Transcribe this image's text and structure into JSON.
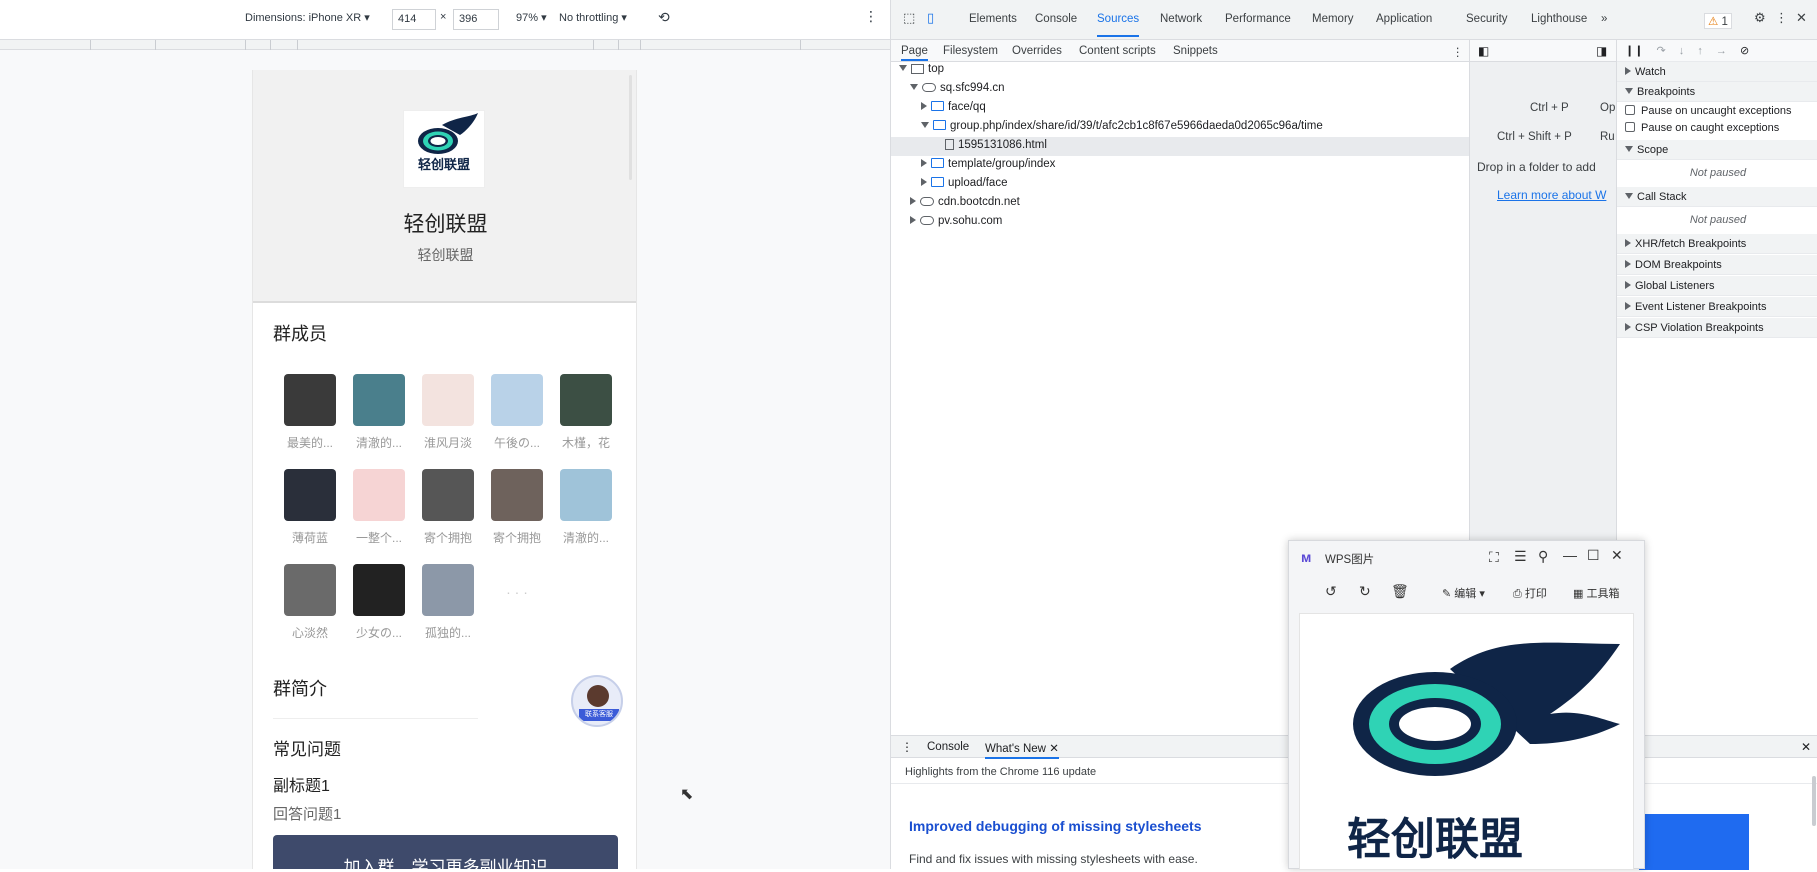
{
  "device_toolbar": {
    "dimensions_label": "Dimensions: iPhone XR",
    "width": "414",
    "times": "×",
    "height": "396",
    "zoom": "97%",
    "throttling": "No throttling"
  },
  "phone": {
    "group_title": "轻创联盟",
    "group_subtitle": "轻创联盟",
    "logo_text": "轻创联盟",
    "members_title": "群成员",
    "members": [
      {
        "name": "最美的...",
        "color": "#3a3a3a"
      },
      {
        "name": "清澈的...",
        "color": "#4a7f8c"
      },
      {
        "name": "淮风月淡",
        "color": "#f3e3df"
      },
      {
        "name": "午後の...",
        "color": "#b9d2e8"
      },
      {
        "name": "木槿，花",
        "color": "#3c4f44"
      },
      {
        "name": "薄荷蓝",
        "color": "#2a2f3a"
      },
      {
        "name": "一整个...",
        "color": "#f6d4d4"
      },
      {
        "name": "寄个拥抱",
        "color": "#565656"
      },
      {
        "name": "寄个拥抱",
        "color": "#6e625c"
      },
      {
        "name": "清澈的...",
        "color": "#9fc3d9"
      },
      {
        "name": "心淡然",
        "color": "#6a6a6a"
      },
      {
        "name": "少女の...",
        "color": "#222222"
      },
      {
        "name": "孤独的...",
        "color": "#8c98a8"
      }
    ],
    "intro_title": "群简介",
    "faq_title": "常见问题",
    "faq_subtitle": "副标题1",
    "faq_answer": "回答问题1",
    "join_button": "加入群，学习更多副业知识",
    "service_badge": "联系客服"
  },
  "devtools": {
    "tabs": [
      "Elements",
      "Console",
      "Sources",
      "Network",
      "Performance",
      "Memory",
      "Application",
      "Security",
      "Lighthouse"
    ],
    "active_tab": "Sources",
    "more_tabs": "»",
    "warning_count": "1",
    "sub_tabs": [
      "Page",
      "Filesystem",
      "Overrides",
      "Content scripts",
      "Snippets"
    ],
    "tree": {
      "top": "top",
      "domain": "sq.sfc994.cn",
      "face": "face/qq",
      "group": "group.php/index/share/id/39/t/afc2cb1c8f67e5966daeda0d2065c96a/time",
      "file": "1595131086.html",
      "template": "template/group/index",
      "upload": "upload/face",
      "cdn": "cdn.bootcdn.net",
      "sohu": "pv.sohu.com"
    },
    "editor": {
      "shortcut1": "Ctrl + P",
      "shortcut1_action": "Op",
      "shortcut2": "Ctrl + Shift + P",
      "shortcut2_action": "Ru",
      "drop_text": "Drop in a folder to add",
      "learn_more": "Learn more about W"
    },
    "right_panel": {
      "watch": "Watch",
      "breakpoints": "Breakpoints",
      "pause_uncaught": "Pause on uncaught exceptions",
      "pause_caught": "Pause on caught exceptions",
      "scope": "Scope",
      "not_paused": "Not paused",
      "call_stack": "Call Stack",
      "not_paused2": "Not paused",
      "xhr": "XHR/fetch Breakpoints",
      "dom": "DOM Breakpoints",
      "global": "Global Listeners",
      "event": "Event Listener Breakpoints",
      "csp": "CSP Violation Breakpoints"
    },
    "drawer": {
      "tab_console": "Console",
      "tab_whatsnew": "What's New",
      "highlights": "Highlights from the Chrome 116 update",
      "headline": "Improved debugging of missing stylesheets",
      "body": "Find and fix issues with missing stylesheets with ease."
    }
  },
  "wps": {
    "title": "WPS图片",
    "edit": "编辑",
    "print": "打印",
    "toolbox": "工具箱",
    "logo_text": "轻创联盟"
  }
}
